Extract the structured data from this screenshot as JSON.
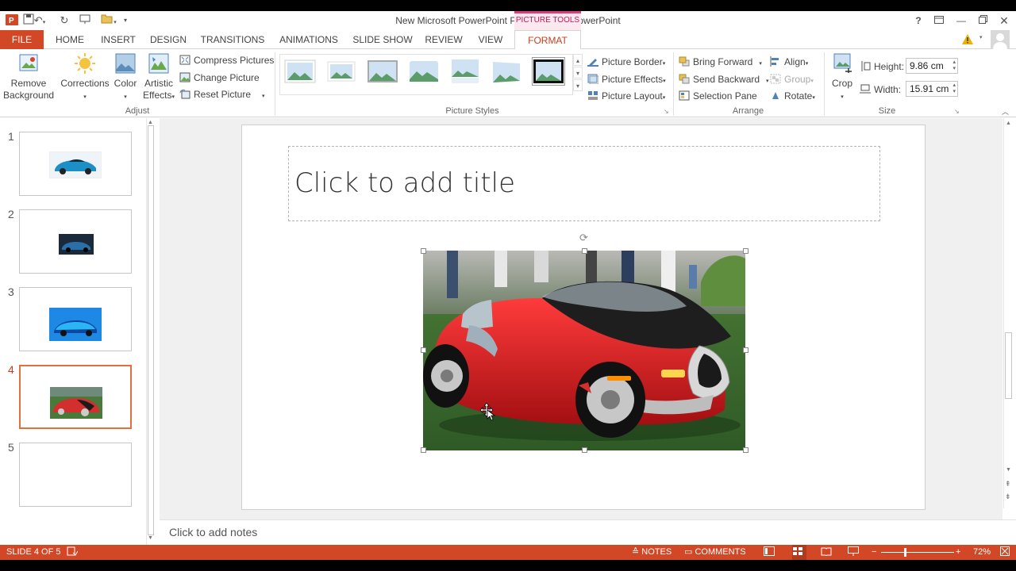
{
  "window": {
    "title": "New Microsoft PowerPoint Presentation - PowerPoint",
    "context_tab_group": "PICTURE TOOLS",
    "help_label": "?"
  },
  "tabs": [
    "FILE",
    "HOME",
    "INSERT",
    "DESIGN",
    "TRANSITIONS",
    "ANIMATIONS",
    "SLIDE SHOW",
    "REVIEW",
    "VIEW",
    "FORMAT"
  ],
  "active_tab": "FORMAT",
  "ribbon": {
    "adjust": {
      "label": "Adjust",
      "remove_background_1": "Remove",
      "remove_background_2": "Background",
      "corrections": "Corrections",
      "color": "Color",
      "artistic_1": "Artistic",
      "artistic_2": "Effects",
      "compress": "Compress Pictures",
      "change": "Change Picture",
      "reset": "Reset Picture"
    },
    "picture_styles": {
      "label": "Picture Styles",
      "border": "Picture Border",
      "effects": "Picture Effects",
      "layout": "Picture Layout"
    },
    "arrange": {
      "label": "Arrange",
      "bring_forward": "Bring Forward",
      "send_backward": "Send Backward",
      "selection_pane": "Selection Pane",
      "align": "Align",
      "group": "Group",
      "rotate": "Rotate"
    },
    "size": {
      "label": "Size",
      "crop": "Crop",
      "height_label": "Height:",
      "height_value": "9.86 cm",
      "width_label": "Width:",
      "width_value": "15.91 cm"
    }
  },
  "slides": [
    {
      "number": "1"
    },
    {
      "number": "2"
    },
    {
      "number": "3"
    },
    {
      "number": "4"
    },
    {
      "number": "5"
    }
  ],
  "active_slide": "4",
  "editor": {
    "title_placeholder": "Click to add title",
    "notes_placeholder": "Click to add notes"
  },
  "statusbar": {
    "slide_indicator": "SLIDE 4 OF 5",
    "notes": "NOTES",
    "comments": "COMMENTS",
    "zoom": "72%"
  },
  "colors": {
    "accent": "#d24726",
    "picture_tools": "#d6417c"
  }
}
